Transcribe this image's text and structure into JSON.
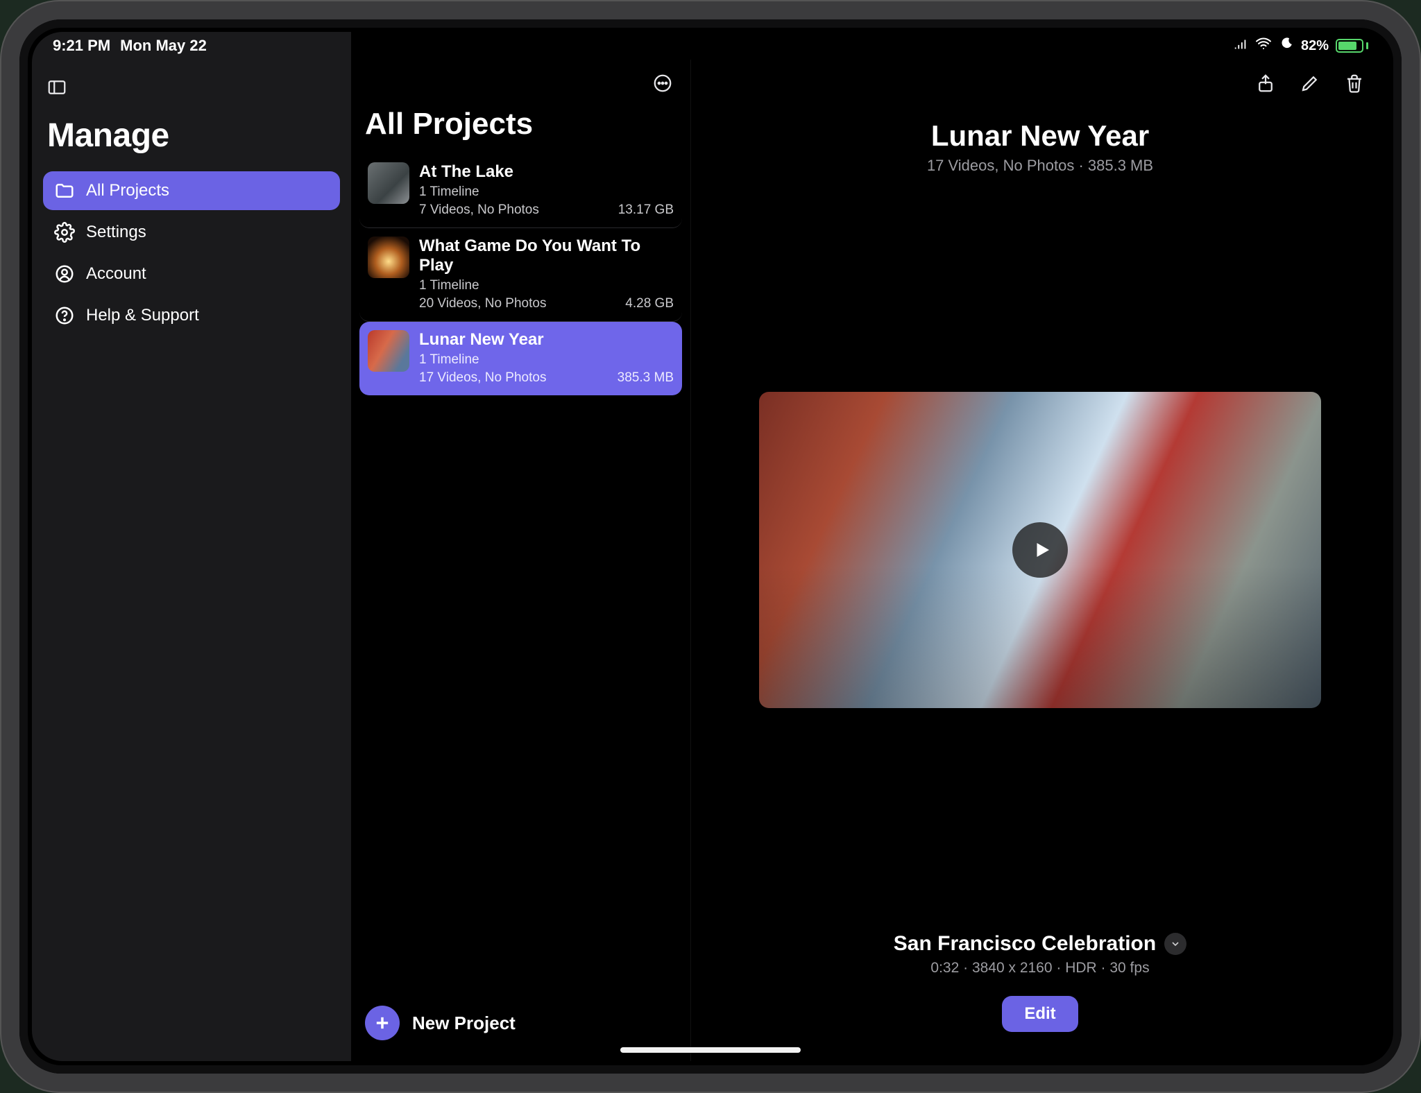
{
  "status": {
    "time": "9:21 PM",
    "date": "Mon May 22",
    "battery_pct": "82%"
  },
  "sidebar": {
    "title": "Manage",
    "items": [
      {
        "label": "All Projects",
        "icon": "folder-icon",
        "active": true
      },
      {
        "label": "Settings",
        "icon": "gear-icon",
        "active": false
      },
      {
        "label": "Account",
        "icon": "person-icon",
        "active": false
      },
      {
        "label": "Help & Support",
        "icon": "help-icon",
        "active": false
      }
    ]
  },
  "projectsColumn": {
    "heading": "All Projects",
    "newButton": "New Project",
    "projects": [
      {
        "title": "At The Lake",
        "timelines": "1 Timeline",
        "media": "7 Videos, No Photos",
        "size": "13.17 GB",
        "thumb": "lake",
        "selected": false
      },
      {
        "title": "What Game Do You Want To Play",
        "timelines": "1 Timeline",
        "media": "20 Videos, No Photos",
        "size": "4.28 GB",
        "thumb": "cake",
        "selected": false
      },
      {
        "title": "Lunar New Year",
        "timelines": "1 Timeline",
        "media": "17 Videos, No Photos",
        "size": "385.3 MB",
        "thumb": "lunar",
        "selected": true
      }
    ]
  },
  "detail": {
    "title": "Lunar New Year",
    "subtitle": "17 Videos, No Photos · 385.3 MB",
    "clipTitle": "San Francisco Celebration",
    "clipMeta": "0:32 · 3840 x 2160 · HDR · 30 fps",
    "editLabel": "Edit"
  },
  "colors": {
    "accent": "#6b63e4"
  }
}
